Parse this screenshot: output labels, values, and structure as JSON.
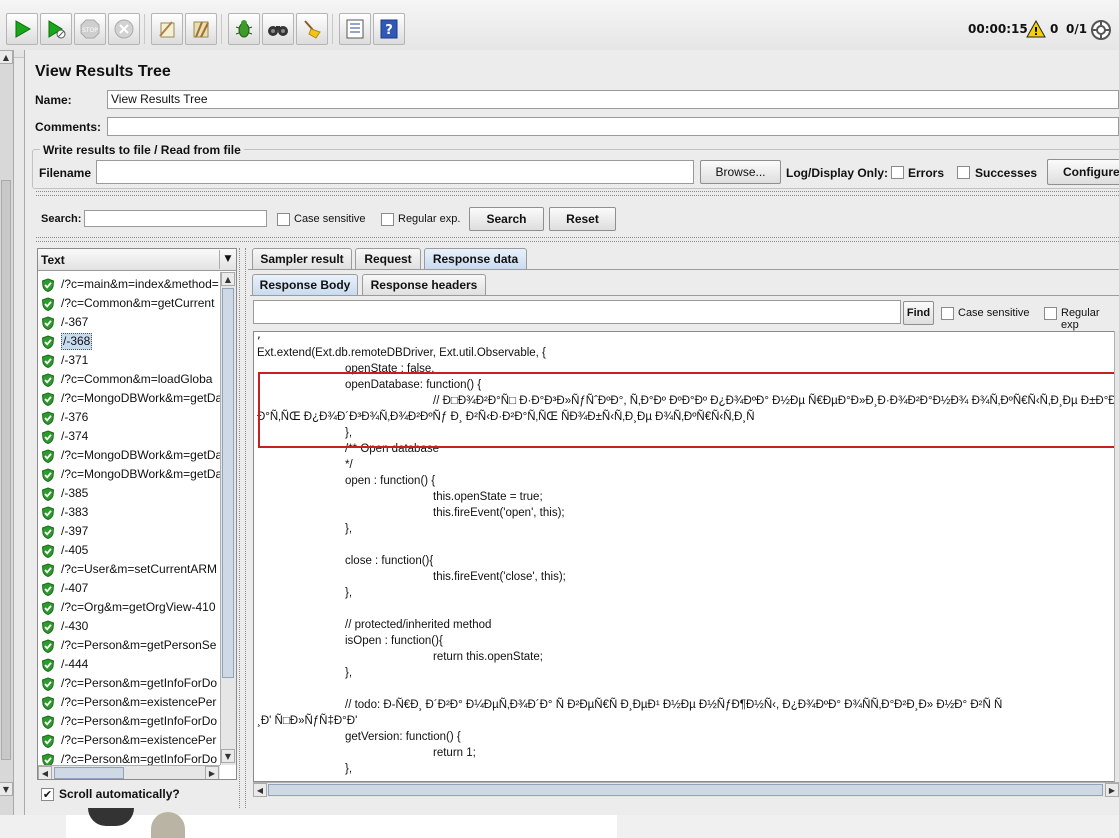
{
  "toolbar": {
    "buttons": [
      "start-icon",
      "start-no-pauses-icon",
      "stop-icon",
      "shutdown-icon",
      "clear-icon",
      "clear-all-icon",
      "function-helper-icon",
      "search-icon",
      "reset-search-icon",
      "view-list-icon",
      "help-icon"
    ],
    "timer": "00:00:15",
    "warning_count": "0",
    "threads": "0/1"
  },
  "panel": {
    "title": "View Results Tree",
    "name_label": "Name:",
    "name_value": "View Results Tree",
    "comments_label": "Comments:",
    "comments_value": "",
    "file_group_title": "Write results to file / Read from file",
    "filename_label": "Filename",
    "filename_value": "",
    "browse_label": "Browse...",
    "log_display_label": "Log/Display Only:",
    "errors_label": "Errors",
    "successes_label": "Successes",
    "configure_label": "Configure"
  },
  "search": {
    "label": "Search:",
    "value": "",
    "case_sensitive": "Case sensitive",
    "regular_exp": "Regular exp.",
    "search_button": "Search",
    "reset_button": "Reset"
  },
  "tree": {
    "header": "Text",
    "items": [
      "/?c=main&m=index&method=",
      "/?c=Common&m=getCurrent",
      "/-367",
      "/-368",
      "/-371",
      "/?c=Common&m=loadGloba",
      "/?c=MongoDBWork&m=getDa",
      "/-376",
      "/-374",
      "/?c=MongoDBWork&m=getDa",
      "/?c=MongoDBWork&m=getDa",
      "/-385",
      "/-383",
      "/-397",
      "/-405",
      "/?c=User&m=setCurrentARM",
      "/-407",
      "/?c=Org&m=getOrgView-410",
      "/-430",
      "/?c=Person&m=getPersonSe",
      "/-444",
      "/?c=Person&m=getInfoForDo",
      "/?c=Person&m=existencePer",
      "/?c=Person&m=getInfoForDo",
      "/?c=Person&m=existencePer",
      "/?c=Person&m=getInfoForDo"
    ],
    "selected_index": 3,
    "scroll_auto_label": "Scroll automatically?",
    "scroll_auto_checked": true
  },
  "result_tabs": {
    "tabs": [
      "Sampler result",
      "Request",
      "Response data"
    ],
    "active": 2,
    "sub_tabs": [
      "Response Body",
      "Response headers"
    ],
    "sub_active": 0
  },
  "response": {
    "find_value": "",
    "find_button": "Find",
    "case_sensitive": "Case sensitive",
    "regular_exp": "Regular exp",
    "lines": [
      {
        "indent": 0,
        "text": "Ext.extend(Ext.db.remoteDBDriver, Ext.util.Observable, {"
      },
      {
        "indent": 1,
        "text": "openState : false,"
      },
      {
        "indent": 1,
        "text": "openDatabase: function() {"
      },
      {
        "indent": 2,
        "text": "// Ð□Ð¾Ð²Ð°Ñ□ Ð·Ð°Ð³Ð»ÑƒÑˆÐºÐ°, Ñ‚Ð°Ðº ÐºÐ°Ðº Ð¿Ð¾ÐºÐ° Ð½Ðµ Ñ€ÐµÐ°Ð»Ð¸Ð·Ð¾Ð²Ð°Ð½Ð¾ Ð¾Ñ‚ÐºÑ€Ñ‹Ñ‚Ð¸Ðµ Ð±Ð°Ð·Ñ‹ Ð"
      },
      {
        "indent": 0,
        "text": "Ð°Ñ‚ÑŒ Ð¿Ð¾Ð´Ð³Ð¾Ñ‚Ð¾Ð²ÐºÑƒ Ð¸ Ð²Ñ‹Ð·Ð²Ð°Ñ‚ÑŒ ÑÐ¾Ð±Ñ‹Ñ‚Ð¸Ðµ Ð¾Ñ‚ÐºÑ€Ñ‹Ñ‚Ð¸Ñ"
      },
      {
        "indent": 1,
        "text": "},"
      },
      {
        "indent": 1,
        "text": "/** Open database"
      },
      {
        "indent": 1,
        "text": " */"
      },
      {
        "indent": 1,
        "text": "open : function() {"
      },
      {
        "indent": 2,
        "text": "this.openState = true;"
      },
      {
        "indent": 2,
        "text": "this.fireEvent('open', this);"
      },
      {
        "indent": 1,
        "text": "},"
      },
      {
        "indent": 1,
        "text": ""
      },
      {
        "indent": 1,
        "text": "close : function(){"
      },
      {
        "indent": 2,
        "text": "this.fireEvent('close', this);"
      },
      {
        "indent": 1,
        "text": "},"
      },
      {
        "indent": 1,
        "text": ""
      },
      {
        "indent": 1,
        "text": "// protected/inherited method"
      },
      {
        "indent": 1,
        "text": "isOpen : function(){"
      },
      {
        "indent": 2,
        "text": "return this.openState;"
      },
      {
        "indent": 1,
        "text": "},"
      },
      {
        "indent": 1,
        "text": ""
      },
      {
        "indent": 1,
        "text": "// todo: Ð-Ñ€Ð¸ Ð´Ð²Ð° Ð¼ÐµÑ‚Ð¾Ð´Ð° Ñ Ð²ÐµÑ€Ñ Ð¸ÐµÐ¹ Ð½Ðµ Ð½ÑƒÐ¶Ð½Ñ‹, Ð¿Ð¾ÐºÐ° Ð¾ÑÑ‚Ð°Ð²Ð¸Ð» Ð½Ð° Ð²Ñ Ñ"
      },
      {
        "indent": 0,
        "text": "¸Ð' Ñ□Ð»ÑƒÑ‡Ð°Ð'"
      },
      {
        "indent": 1,
        "text": "getVersion: function() {"
      },
      {
        "indent": 2,
        "text": "return 1;"
      },
      {
        "indent": 1,
        "text": "},"
      }
    ]
  },
  "colors": {
    "highlight_box": "#c62020",
    "selection": "#c8dcf0",
    "ok_green": "#2e9a2e"
  }
}
